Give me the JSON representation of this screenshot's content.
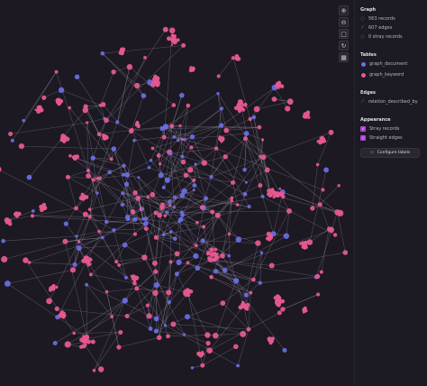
{
  "toolbar": {
    "zoom_in_icon": "⊕",
    "zoom_out_icon": "⊖",
    "fit_icon": "□",
    "rotate_icon": "↻",
    "grid_icon": "▦"
  },
  "sidebar": {
    "graph": {
      "title": "Graph",
      "records": "563 records",
      "edges": "607 edges",
      "stray_records": "0 stray records"
    },
    "tables": {
      "title": "Tables",
      "items": [
        {
          "label": "graph_document",
          "color": "#6a6fe6"
        },
        {
          "label": "graph_keyword",
          "color": "#e5598f"
        }
      ]
    },
    "edges": {
      "title": "Edges",
      "item_label": "relation_described_by"
    },
    "appearance": {
      "title": "Appearance",
      "stray_records_label": "Stray records",
      "straight_edges_label": "Straight edges",
      "configure_labels": "Configure labels"
    }
  }
}
